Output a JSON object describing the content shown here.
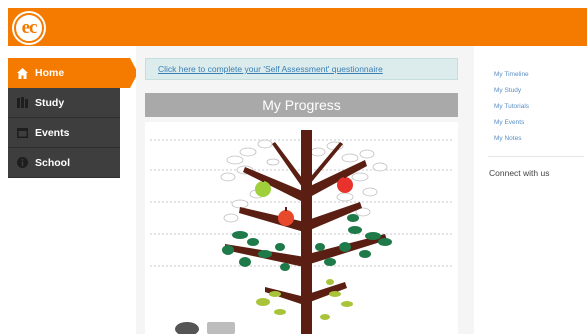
{
  "header": {
    "logo_text": "ec",
    "brand_color": "#f47a00"
  },
  "nav": {
    "items": [
      {
        "label": "Home",
        "icon": "home-icon",
        "active": true
      },
      {
        "label": "Study",
        "icon": "books-icon",
        "active": false
      },
      {
        "label": "Events",
        "icon": "events-icon",
        "active": false
      },
      {
        "label": "School",
        "icon": "info-icon",
        "active": false
      }
    ]
  },
  "main": {
    "banner_link": "Click here to complete your 'Self Assessment' questionnaire",
    "progress_title": "My Progress"
  },
  "right": {
    "links": [
      "My Timeline",
      "My Study",
      "My Tutorials",
      "My Events",
      "My Notes"
    ],
    "connect": "Connect with us"
  },
  "colors": {
    "orange": "#f47a00",
    "nav_dark": "#3e3e3e",
    "title_gray": "#a9a9a9",
    "link_blue": "#5b8fc4"
  }
}
